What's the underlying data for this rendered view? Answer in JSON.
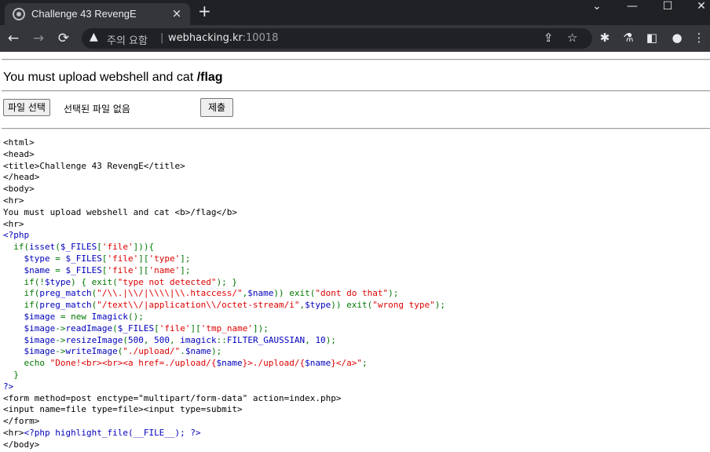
{
  "tab": {
    "title": "Challenge 43 RevengE",
    "close": "×",
    "new_tab": "+"
  },
  "window_controls": {
    "dropdown": "⌄",
    "minimize": "—",
    "maximize": "☐",
    "close": "✕"
  },
  "toolbar": {
    "back": "←",
    "forward": "→",
    "reload": "⟳",
    "warning_icon": "▲",
    "warning_text": "주의 요함",
    "separator": "|",
    "url_host": "webhacking.kr",
    "url_port": ":10018",
    "share_icon": "⇪",
    "star_icon": "☆",
    "extensions_icon": "✱",
    "labs_icon": "⚗",
    "sidepanel_icon": "◧",
    "profile_icon": "●",
    "menu_icon": "⋮"
  },
  "page": {
    "message_prefix": "You must upload webshell and cat ",
    "message_bold": "/flag",
    "file_button": "파일 선택",
    "no_file_text": "선택된 파일 없음",
    "submit_label": "제출"
  },
  "source": {
    "html_head": "<html>\n<head>\n<title>Challenge 43 RevengE</title>\n</head>\n<body>\n<hr>\nYou must upload webshell and cat <b>/flag</b>\n<hr>\n",
    "php_open": "<?php",
    "lines": [
      [
        [
          "k",
          "\n  if("
        ],
        [
          "v",
          "isset"
        ],
        [
          "k",
          "("
        ],
        [
          "v",
          "$_FILES"
        ],
        [
          "k",
          "["
        ],
        [
          "s",
          "'file'"
        ],
        [
          "k",
          "])){"
        ]
      ],
      [
        [
          "k",
          "\n    "
        ],
        [
          "v",
          "$type "
        ],
        [
          "k",
          "= "
        ],
        [
          "v",
          "$_FILES"
        ],
        [
          "k",
          "["
        ],
        [
          "s",
          "'file'"
        ],
        [
          "k",
          "]["
        ],
        [
          "s",
          "'type'"
        ],
        [
          "k",
          "];"
        ]
      ],
      [
        [
          "k",
          "\n    "
        ],
        [
          "v",
          "$name "
        ],
        [
          "k",
          "= "
        ],
        [
          "v",
          "$_FILES"
        ],
        [
          "k",
          "["
        ],
        [
          "s",
          "'file'"
        ],
        [
          "k",
          "]["
        ],
        [
          "s",
          "'name'"
        ],
        [
          "k",
          "];"
        ]
      ],
      [
        [
          "k",
          "\n    if(!"
        ],
        [
          "v",
          "$type"
        ],
        [
          "k",
          ") { exit("
        ],
        [
          "s",
          "\"type not detected\""
        ],
        [
          "k",
          "); }"
        ]
      ],
      [
        [
          "k",
          "\n    if("
        ],
        [
          "v",
          "preg_match"
        ],
        [
          "k",
          "("
        ],
        [
          "s",
          "\"/\\\\.|\\\\/|\\\\\\\\|\\\\.htaccess/\""
        ],
        [
          "k",
          ","
        ],
        [
          "v",
          "$name"
        ],
        [
          "k",
          ")) exit("
        ],
        [
          "s",
          "\"dont do that\""
        ],
        [
          "k",
          ");"
        ]
      ],
      [
        [
          "k",
          "\n    if("
        ],
        [
          "v",
          "preg_match"
        ],
        [
          "k",
          "("
        ],
        [
          "s",
          "\"/text\\\\/|application\\\\/octet-stream/i\""
        ],
        [
          "k",
          ","
        ],
        [
          "v",
          "$type"
        ],
        [
          "k",
          ")) exit("
        ],
        [
          "s",
          "\"wrong type\""
        ],
        [
          "k",
          ");"
        ]
      ],
      [
        [
          "k",
          "\n    "
        ],
        [
          "v",
          "$image "
        ],
        [
          "k",
          "= new "
        ],
        [
          "v",
          "Imagick"
        ],
        [
          "k",
          "();"
        ]
      ],
      [
        [
          "k",
          "\n    "
        ],
        [
          "v",
          "$image"
        ],
        [
          "k",
          "->"
        ],
        [
          "v",
          "readImage"
        ],
        [
          "k",
          "("
        ],
        [
          "v",
          "$_FILES"
        ],
        [
          "k",
          "["
        ],
        [
          "s",
          "'file'"
        ],
        [
          "k",
          "]["
        ],
        [
          "s",
          "'tmp_name'"
        ],
        [
          "k",
          "]);"
        ]
      ],
      [
        [
          "k",
          "\n    "
        ],
        [
          "v",
          "$image"
        ],
        [
          "k",
          "->"
        ],
        [
          "v",
          "resizeImage"
        ],
        [
          "k",
          "("
        ],
        [
          "v",
          "500"
        ],
        [
          "k",
          ", "
        ],
        [
          "v",
          "500"
        ],
        [
          "k",
          ", "
        ],
        [
          "v",
          "imagick"
        ],
        [
          "k",
          "::"
        ],
        [
          "v",
          "FILTER_GAUSSIAN"
        ],
        [
          "k",
          ", "
        ],
        [
          "v",
          "10"
        ],
        [
          "k",
          ");"
        ]
      ],
      [
        [
          "k",
          "\n    "
        ],
        [
          "v",
          "$image"
        ],
        [
          "k",
          "->"
        ],
        [
          "v",
          "writeImage"
        ],
        [
          "k",
          "("
        ],
        [
          "s",
          "\"./upload/\""
        ],
        [
          "k",
          "."
        ],
        [
          "v",
          "$name"
        ],
        [
          "k",
          ");"
        ]
      ],
      [
        [
          "k",
          "\n    echo "
        ],
        [
          "s",
          "\"Done!<br><br><a href=./upload/{"
        ],
        [
          "v",
          "$name"
        ],
        [
          "s",
          "}>./upload/{"
        ],
        [
          "v",
          "$name"
        ],
        [
          "s",
          "}</a>\""
        ],
        [
          "k",
          ";"
        ]
      ],
      [
        [
          "k",
          "\n  }\n"
        ]
      ]
    ],
    "php_close": "?>",
    "html_tail": "\n<form method=post enctype=\"multipart/form-data\" action=index.php>\n<input name=file type=file><input type=submit>\n</form>\n<hr>",
    "highlight_code": "<?php highlight_file(__FILE__); ?>",
    "body_close": "\n</body>"
  }
}
